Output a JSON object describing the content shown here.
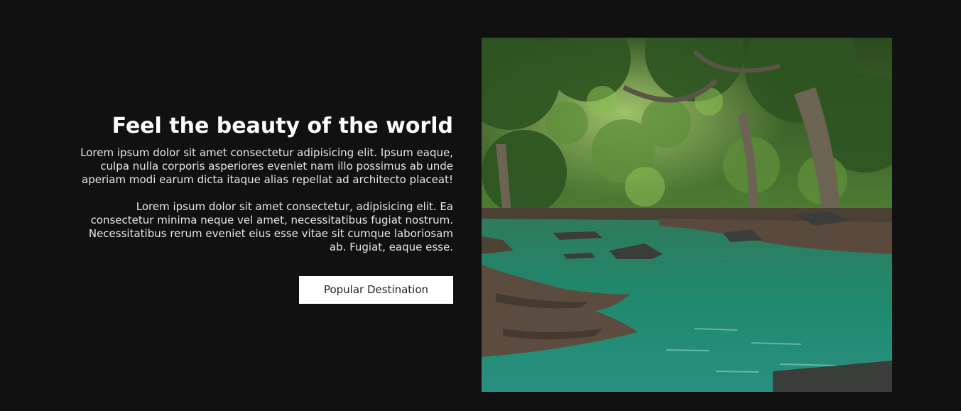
{
  "hero": {
    "title": "Feel the beauty of the world",
    "paragraph_1": "Lorem ipsum dolor sit amet consectetur adipisicing elit. Ipsum eaque, culpa nulla corporis asperiores eveniet nam illo possimus ab unde aperiam modi earum dicta itaque alias repellat ad architecto placeat!",
    "paragraph_2": "Lorem ipsum dolor sit amet consectetur, adipisicing elit. Ea consectetur minima neque vel amet, necessitatibus fugiat nostrum. Necessitatibus rerum eveniet eius esse vitae sit cumque laboriosam ab. Fugiat, eaque esse.",
    "cta_label": "Popular Destination"
  },
  "colors": {
    "background": "#111111",
    "text": "#e6e6e6",
    "button_bg": "#ffffff",
    "button_text": "#222222",
    "water": "#1f8a6e",
    "foliage": "#3f6b2a"
  }
}
